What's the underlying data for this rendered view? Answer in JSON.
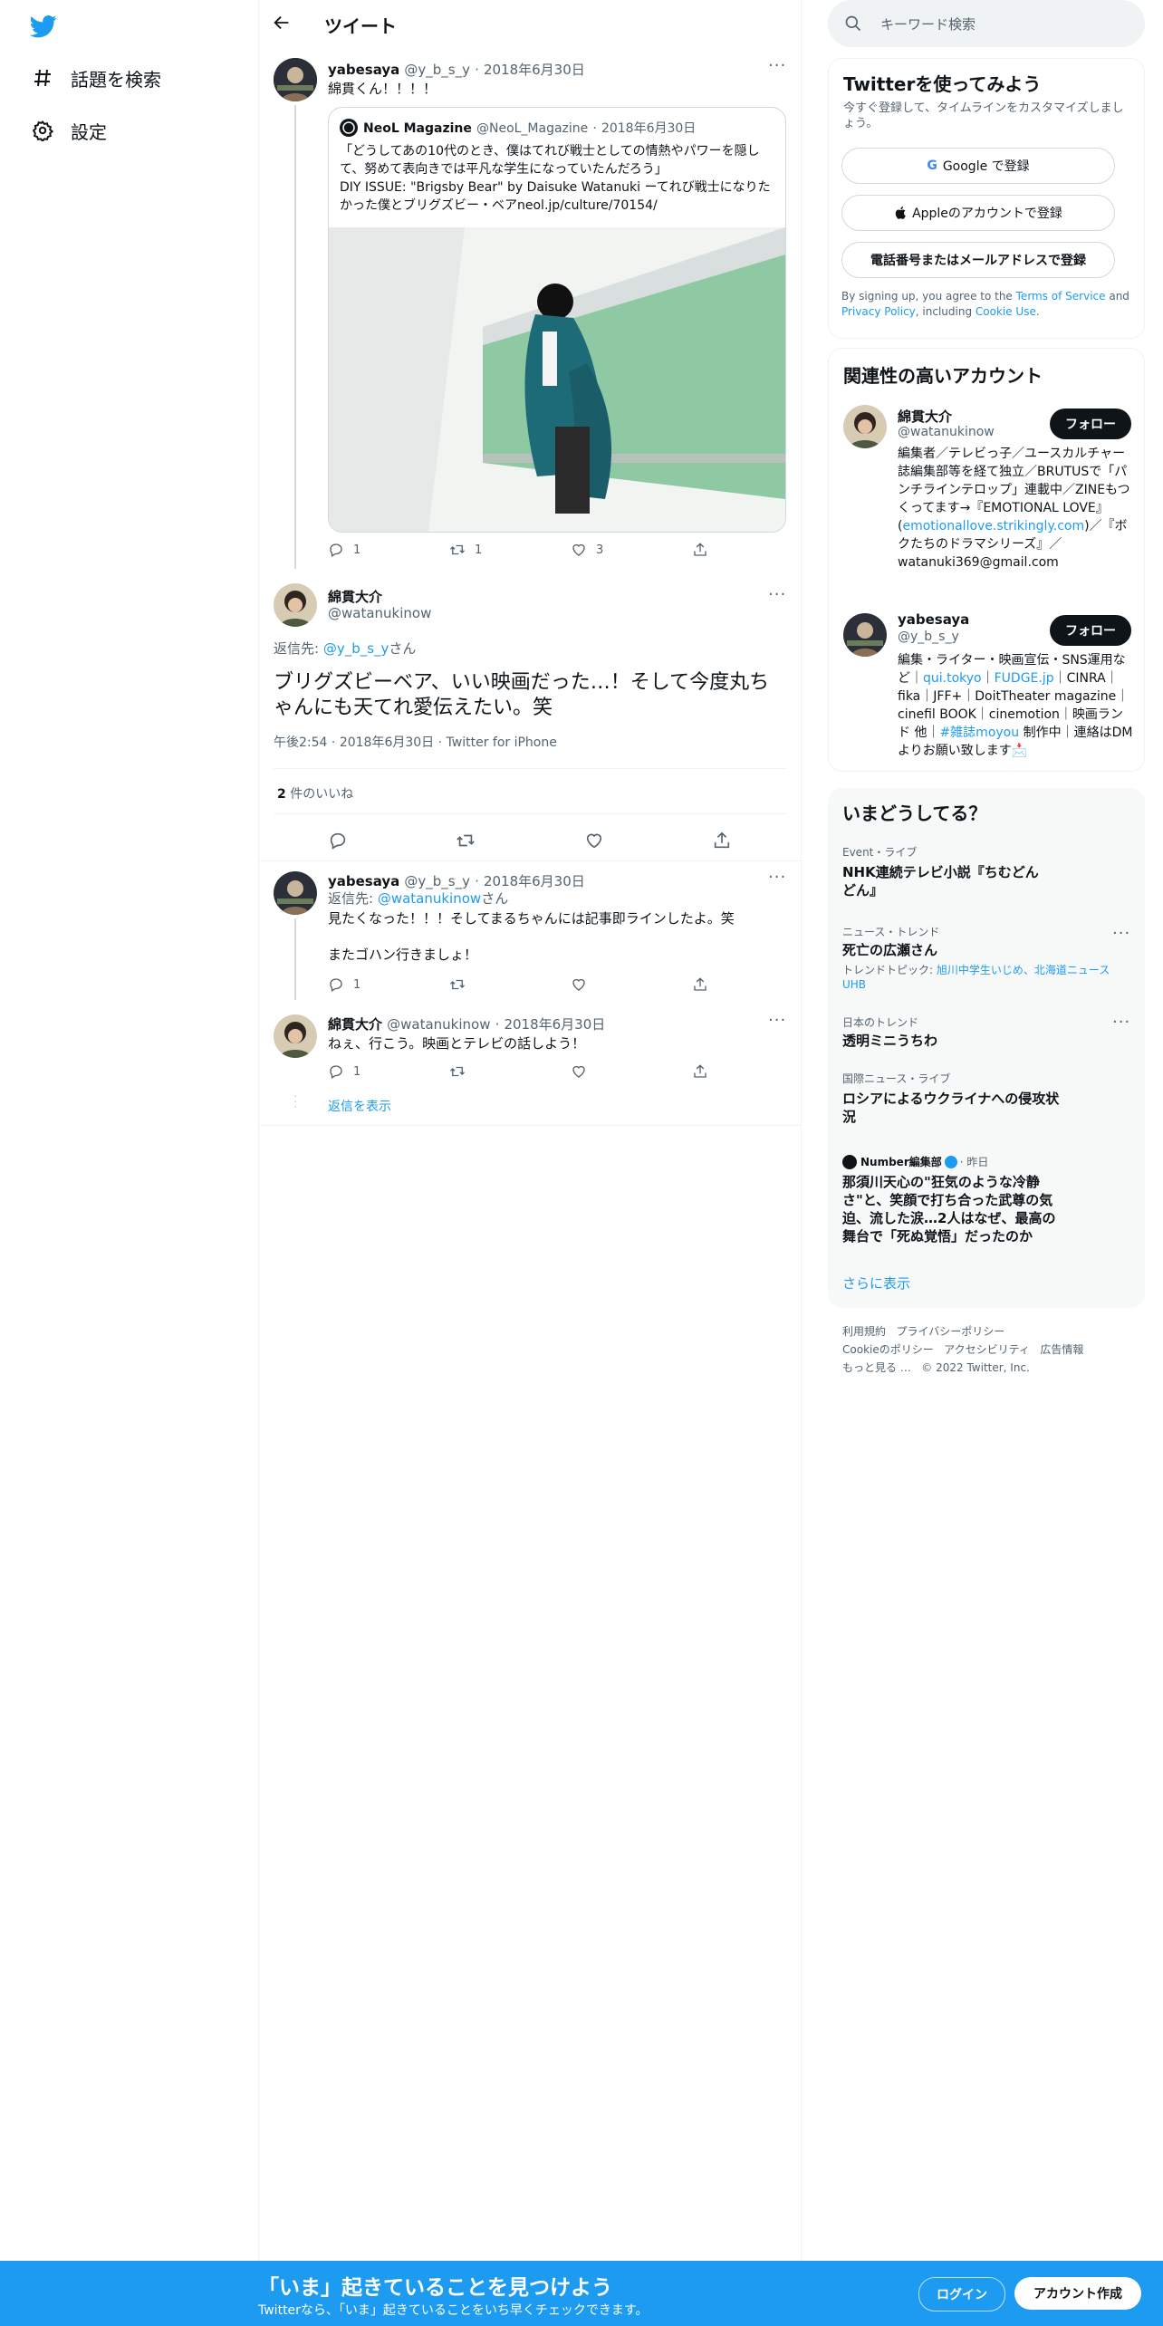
{
  "nav": {
    "explore_label": "話題を検索",
    "settings_label": "設定"
  },
  "header": {
    "title": "ツイート"
  },
  "tweet1": {
    "name": "yabesaya",
    "handle": "@y_b_s_y",
    "date": "2018年6月30日",
    "text": "綿貫くん！！！！",
    "quote": {
      "name": "NeoL Magazine",
      "handle": "@NeoL_Magazine",
      "date": "2018年6月30日",
      "text": "「どうしてあの10代のとき、僕はてれび戦士としての情熱やパワーを隠して、努めて表向きでは平凡な学生になっていたんだろう」\nDIY ISSUE: \"Brigsby Bear\" by Daisuke Watanuki ーてれび戦士になりたかった僕とブリグズビー・ベアneol.jp/culture/70154/"
    },
    "replies": "1",
    "retweets": "1",
    "likes": "3"
  },
  "main_tweet": {
    "name": "綿貫大介",
    "handle": "@watanukinow",
    "reply_to_prefix": "返信先: ",
    "reply_to_handle": "@y_b_s_y",
    "reply_to_suffix": "さん",
    "text": "ブリグズビーベア、いい映画だった…！そして今度丸ちゃんにも天てれ愛伝えたい。笑",
    "time": "午後2:54",
    "date": "2018年6月30日",
    "source": "Twitter for iPhone",
    "likes_count": "2",
    "likes_label": " 件のいいね"
  },
  "reply1": {
    "name": "yabesaya",
    "handle": "@y_b_s_y",
    "date": "2018年6月30日",
    "reply_to_prefix": "返信先: ",
    "reply_to_handle": "@watanukinow",
    "reply_to_suffix": "さん",
    "line1": "見たくなった！！！そしてまるちゃんには記事即ラインしたよ。笑",
    "line2": "またゴハン行きましょ！",
    "replies": "1"
  },
  "reply2": {
    "name": "綿貫大介",
    "handle": "@watanukinow",
    "date": "2018年6月30日",
    "text": "ねぇ、行こう。映画とテレビの話しよう！",
    "replies": "1",
    "show_replies": "返信を表示"
  },
  "search": {
    "placeholder": "キーワード検索"
  },
  "signup": {
    "title": "Twitterを使ってみよう",
    "subtitle": "今すぐ登録して、タイムラインをカスタマイズしましょう。",
    "google": "Google で登録",
    "apple": "Appleのアカウントで登録",
    "phone": "電話番号またはメールアドレスで登録",
    "legal_1": "By signing up, you agree to the ",
    "terms": "Terms of Service",
    "legal_2": " and ",
    "privacy": "Privacy Policy",
    "legal_3": ", including ",
    "cookie": "Cookie Use",
    "legal_4": "."
  },
  "related": {
    "title": "関連性の高いアカウント",
    "follow_label": "フォロー",
    "accounts": [
      {
        "name": "綿貫大介",
        "handle": "@watanukinow",
        "bio_1": "編集者／テレビっ子／ユースカルチャー誌編集部等を経て独立／BRUTUSで「パンチラインテロップ」連載中／ZINEもつくってます→『EMOTIONAL LOVE』(",
        "bio_link": "emotionallove.strikingly.com",
        "bio_2": ")／『ボクたちのドラマシリーズ』／watanuki369@gmail.com"
      },
      {
        "name": "yabesaya",
        "handle": "@y_b_s_y",
        "bio_1": "編集・ライター・映画宣伝・SNS運用など｜",
        "bio_link1": "qui.tokyo",
        "bio_sep": "｜",
        "bio_link2": "FUDGE.jp",
        "bio_2": "｜CINRA｜fika｜JFF+｜DoitTheater magazine｜cinefil BOOK｜cinemotion｜映画ランド 他｜",
        "bio_link3": "#雑誌moyou",
        "bio_3": " 制作中｜連絡はDMよりお願い致します📩"
      }
    ]
  },
  "trends": {
    "title": "いまどうしてる？",
    "items": [
      {
        "context": "Event・ライブ",
        "title": "NHK連続テレビ小説『ちむどんどん』"
      },
      {
        "context": "ニュース・トレンド",
        "title": "死亡の広瀬さん",
        "topic_prefix": "トレンドトピック: ",
        "topic": "旭川中学生いじめ、北海道ニュースUHB"
      },
      {
        "context": "日本のトレンド",
        "title": "透明ミニうちわ"
      },
      {
        "context": "国際ニュース・ライブ",
        "title": "ロシアによるウクライナへの侵攻状況"
      },
      {
        "source": "Number編集部",
        "time": "昨日",
        "title": "那須川天心の\"狂気のような冷静さ\"と、笑顔で打ち合った武尊の気迫、流した涙…2人はなぜ、最高の舞台で「死ぬ覚悟」だったのか"
      }
    ],
    "more": "さらに表示"
  },
  "footer": {
    "links_row1": [
      "利用規約",
      "プライバシーポリシー"
    ],
    "links_row2": [
      "Cookieのポリシー",
      "アクセシビリティ",
      "広告情報"
    ],
    "more": "もっと見る …",
    "copyright": "© 2022 Twitter, Inc."
  },
  "banner": {
    "title": "「いま」起きていることを見つけよう",
    "subtitle": "Twitterなら、「いま」起きていることをいち早くチェックできます。",
    "login": "ログイン",
    "signup": "アカウント作成"
  },
  "colors": {
    "accent": "#1d9bf0",
    "text": "#0f1419",
    "muted": "#536471"
  }
}
